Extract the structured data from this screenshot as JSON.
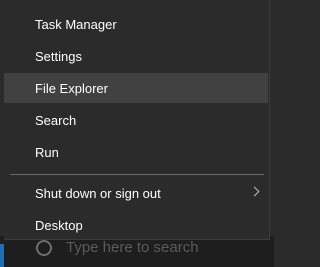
{
  "menu": {
    "items": [
      {
        "label": "Task Manager"
      },
      {
        "label": "Settings"
      },
      {
        "label": "File Explorer",
        "highlighted": true
      },
      {
        "label": "Search"
      },
      {
        "label": "Run"
      },
      {
        "label": "Shut down or sign out",
        "has_submenu": true
      },
      {
        "label": "Desktop"
      }
    ],
    "hover_color": "#414141",
    "background_color": "#2b2b2b"
  },
  "taskbar": {
    "search_placeholder": "Type here to search",
    "search_icon": "search-icon",
    "accent_color": "#1d6fb8"
  }
}
